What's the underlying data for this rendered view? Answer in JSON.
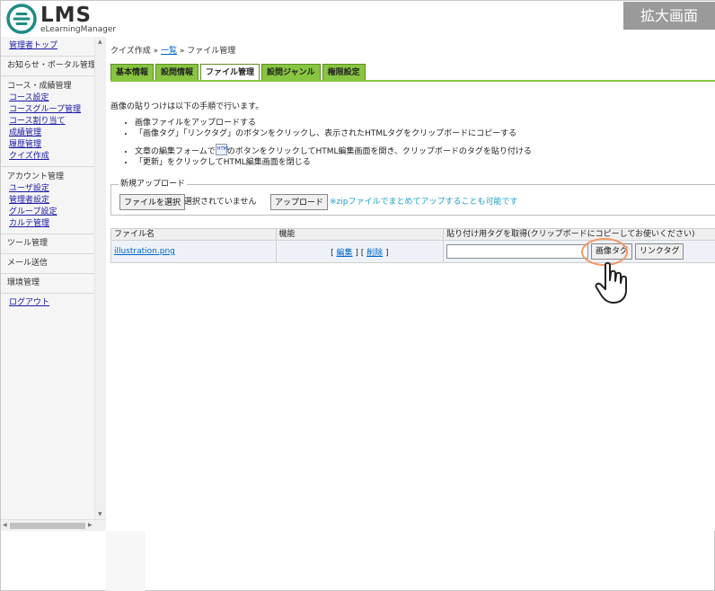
{
  "header": {
    "logo_text": "LMS",
    "logo_sub": "eLearningManager",
    "zoom_label": "拡大画面"
  },
  "sidebar": {
    "admin_top": "管理者トップ",
    "notice_portal": "お知らせ・ポータル管理",
    "course_head": "コース・成績管理",
    "course_links": [
      "コース設定",
      "コースグループ管理",
      "コース割り当て",
      "成績管理",
      "履歴管理",
      "クイズ作成"
    ],
    "account_head": "アカウント管理",
    "account_links": [
      "ユーザ設定",
      "管理者設定",
      "グループ設定",
      "カルテ管理"
    ],
    "tools": "ツール管理",
    "mail": "メール送信",
    "env": "環境管理",
    "logout": "ログアウト"
  },
  "breadcrumb": {
    "quiz": "クイズ作成",
    "sep1": "»",
    "list": "一覧",
    "sep2": "»",
    "current": "ファイル管理"
  },
  "tabs": [
    "基本情報",
    "設問情報",
    "ファイル管理",
    "設問ジャンル",
    "権限設定"
  ],
  "active_tab": "ファイル管理",
  "intro": "画像の貼りつけは以下の手順で行います。",
  "steps": {
    "s1": "画像ファイルをアップロードする",
    "s2": "「画像タグ」「リンクタグ」のボタンをクリックし、表示されたHTMLタグをクリップボードにコピーする",
    "s3a": "文章の編集フォームで",
    "s3_icon": "HTML",
    "s3b": "のボタンをクリックしてHTML編集画面を開き、クリップボードのタグを貼り付ける",
    "s4": "「更新」をクリックしてHTML編集画面を閉じる"
  },
  "upload": {
    "legend": "新規アップロード",
    "choose_button": "ファイルを選択",
    "no_file": "選択されていません",
    "upload_button": "アップロード",
    "zip_note": "※zipファイルでまとめてアップすることも可能です"
  },
  "table": {
    "headers": [
      "ファイル名",
      "機能",
      "貼り付け用タグを取得(クリップボードにコピーしてお使いください)"
    ],
    "rows": [
      {
        "file_name": "illustration.png",
        "ops_open": "[",
        "edit": "編集",
        "ops_mid": "] [",
        "delete": "削除",
        "ops_close": "]",
        "tag_value": "",
        "image_tag_button": "画像タグ",
        "link_tag_button": "リンクタグ"
      }
    ]
  },
  "colors": {
    "tab_green": "#88c541",
    "highlight": "#f29a6a",
    "note_cyan": "#1aa0c8",
    "logo_teal": "#1e8c84"
  },
  "icons": [
    "logo-mark-icon",
    "html-editor-icon",
    "hand-pointer-icon"
  ]
}
